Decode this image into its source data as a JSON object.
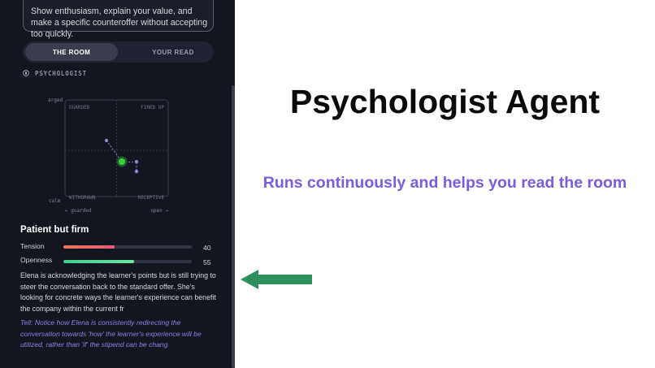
{
  "panel": {
    "prompt_text": "Show enthusiasm, explain your value, and make a specific counteroffer without accepting too quickly.",
    "tabs": [
      {
        "label": "THE ROOM",
        "active": true
      },
      {
        "label": "YOUR READ",
        "active": false
      }
    ],
    "agent_label": "PSYCHOLOGIST",
    "quadrant": {
      "y_top_label": "arged",
      "y_bottom_label": "calm",
      "x_left_label": "← guarded",
      "x_right_label": "open →",
      "quadrants": [
        "GUARDED",
        "FIRED UP",
        "WITHDRAWN",
        "RECEPTIVE"
      ],
      "trail_color": "#8a85dd",
      "current_color": "#3ecf3e"
    },
    "state_title": "Patient but firm",
    "metrics": [
      {
        "label": "Tension",
        "value": "40",
        "fraction": 0.4,
        "color_from": "#e9795b",
        "color_to": "#f0557a"
      },
      {
        "label": "Openness",
        "value": "55",
        "fraction": 0.55,
        "color_from": "#3fcf8e",
        "color_to": "#6ee6a4"
      }
    ],
    "description": "Elena is acknowledging the learner's points but is still trying to steer the conversation back to the standard offer. She's looking for concrete ways the learner's experience can benefit the company within the current fr",
    "tell": "Tell: Notice how Elena is consistently redirecting the conversation towards 'how' the learner's experience will be utilized, rather than 'if' the stipend can be chang"
  },
  "slide": {
    "title": "Psychologist Agent",
    "subtitle": "Runs continuously and helps you read the room",
    "arrow_color": "#2f8f5e"
  }
}
